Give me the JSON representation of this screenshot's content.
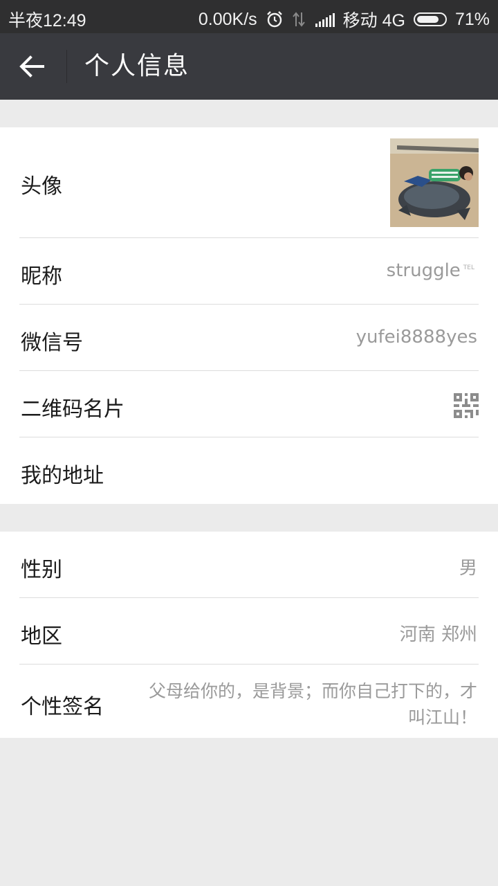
{
  "status_bar": {
    "time": "半夜12:49",
    "net_speed": "0.00K/s",
    "carrier": "移动 4G",
    "battery": "71%",
    "icons": [
      "alarm-icon",
      "data-transfer-icon",
      "signal-icon",
      "battery-icon"
    ]
  },
  "header": {
    "title": "个人信息",
    "back_icon": "back-arrow-icon"
  },
  "profile": {
    "avatar_label": "头像",
    "nickname_label": "昵称",
    "nickname_value": "struggle",
    "nickname_badge": "TEL",
    "wechat_id_label": "微信号",
    "wechat_id_value": "yufei8888yes",
    "qr_label": "二维码名片",
    "address_label": "我的地址"
  },
  "details": {
    "gender_label": "性别",
    "gender_value": "男",
    "region_label": "地区",
    "region_value": "河南 郑州",
    "signature_label": "个性签名",
    "signature_value": "父母给你的，是背景；而你自己打下的，才叫江山！"
  },
  "colors": {
    "title_bar": "#393a3f",
    "status_bar": "#2f2f30",
    "background": "#ebebeb",
    "secondary_text": "#9a9a9a"
  }
}
